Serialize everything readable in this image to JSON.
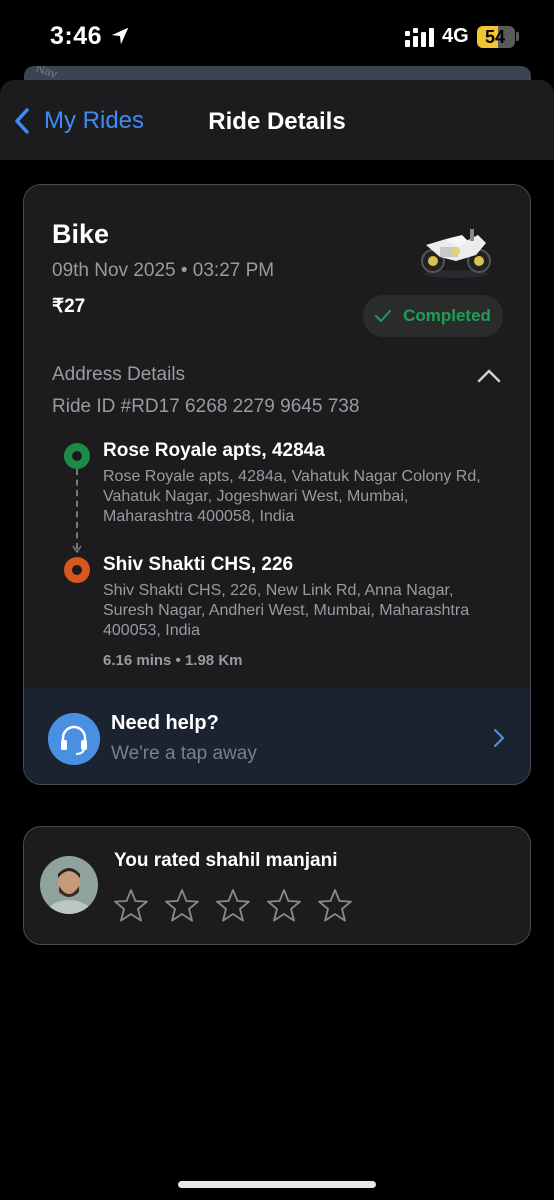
{
  "status_bar": {
    "time": "3:46",
    "network": "4G",
    "battery": "54"
  },
  "map": {
    "label": "Nav"
  },
  "nav": {
    "back_label": "My Rides",
    "title": "Ride Details"
  },
  "ride": {
    "vehicle_type": "Bike",
    "datetime": "09th Nov 2025 • 03:27 PM",
    "fare": "₹27",
    "status": "Completed",
    "address_section_label": "Address Details",
    "ride_id": "Ride ID #RD17 6268 2279 9645 738",
    "pickup": {
      "title": "Rose Royale apts, 4284a",
      "address": "Rose Royale apts, 4284a, Vahatuk Nagar Colony Rd, Vahatuk Nagar, Jogeshwari West, Mumbai, Maharashtra 400058, India"
    },
    "drop": {
      "title": "Shiv Shakti CHS, 226",
      "address": "Shiv Shakti CHS, 226, New Link Rd, Anna Nagar, Suresh Nagar, Andheri West, Mumbai, Maharashtra 400053, India"
    },
    "trip_stats": "6.16 mins • 1.98 Km"
  },
  "help": {
    "title": "Need help?",
    "subtitle": "We're a tap away"
  },
  "rating": {
    "title": "You rated shahil manjani",
    "stars_filled": 0,
    "stars_total": 5
  },
  "colors": {
    "accent": "#3b8cf7",
    "completed": "#1f9d55",
    "pickup": "#1e8a4a",
    "drop": "#d9561d",
    "help_bg": "#1b2230"
  },
  "icons": [
    "location-arrow-icon",
    "signal-icon",
    "battery-icon",
    "back-chevron-icon",
    "bike-icon",
    "check-icon",
    "chevron-up-icon",
    "route-arrow-icon",
    "headset-icon",
    "chevron-right-icon",
    "star-outline-icon"
  ]
}
